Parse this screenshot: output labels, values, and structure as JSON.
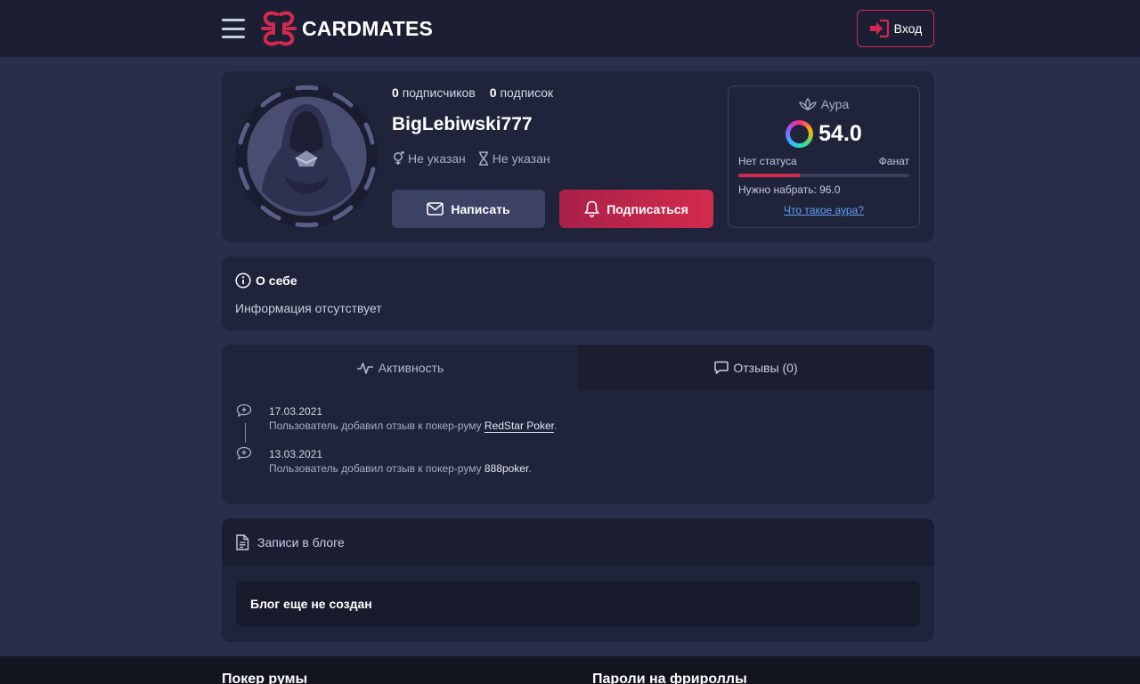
{
  "header": {
    "brand": "CARDMATES",
    "login_label": "Вход"
  },
  "profile": {
    "followers_count": "0",
    "followers_label": "подписчиков",
    "following_count": "0",
    "following_label": "подписок",
    "username": "BigLebiwski777",
    "gender": "Не указан",
    "age": "Не указан",
    "write_label": "Написать",
    "subscribe_label": "Подписаться"
  },
  "aura": {
    "title": "Аура",
    "value": "54.0",
    "level_from": "Нет статуса",
    "level_to": "Фанат",
    "progress_percent": 36,
    "need_text": "Нужно набрать: 96.0",
    "link_text": "Что такое аура?"
  },
  "about": {
    "title": "О себе",
    "text": "Информация отсутствует"
  },
  "tabs": [
    {
      "label": "Активность"
    },
    {
      "label": "Отзывы (0)"
    }
  ],
  "feed": [
    {
      "date": "17.03.2021",
      "text": "Пользователь добавил отзыв к покер-руму ",
      "link": "RedStar Poker",
      "suffix": "."
    },
    {
      "date": "13.03.2021",
      "text": "Пользователь добавил отзыв к покер-руму ",
      "link": "888poker",
      "suffix": "."
    }
  ],
  "blog": {
    "title": "Записи в блоге",
    "empty_text": "Блог еще не создан"
  },
  "footer": {
    "col1_title": "Покер румы",
    "col2_title": "Пароли на фрироллы"
  },
  "colors": {
    "accent": "#d2294f",
    "link": "#5ea0f5",
    "background": "#2a2e4a",
    "card": "#20243b"
  }
}
